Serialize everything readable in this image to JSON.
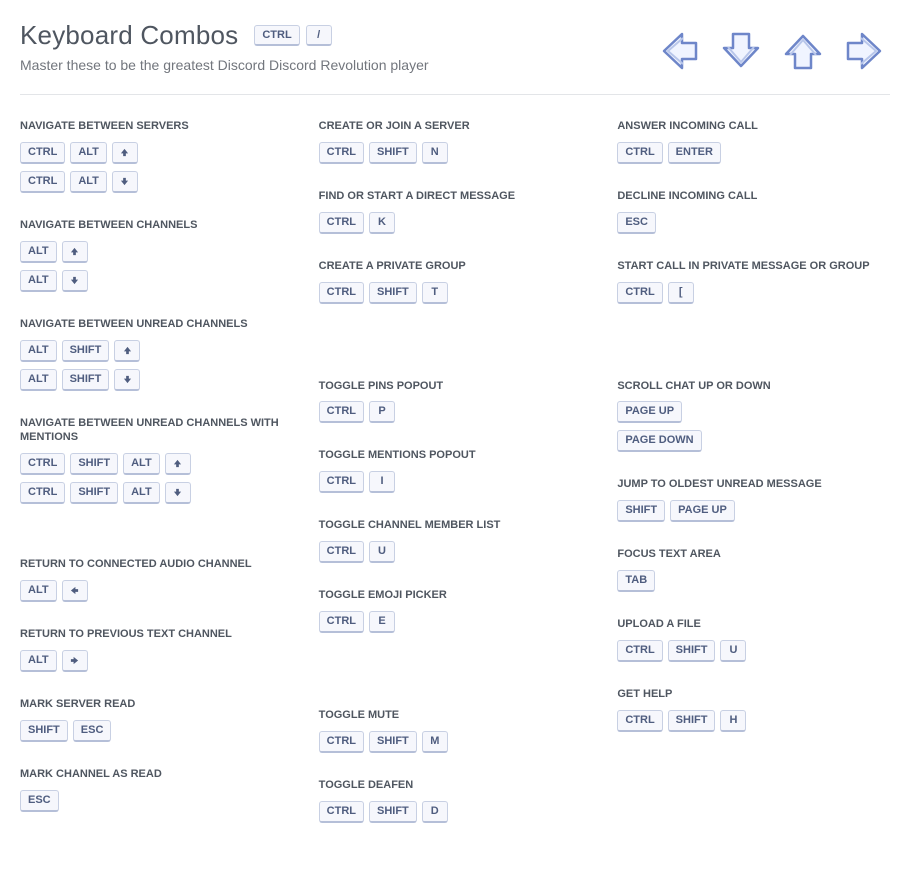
{
  "header": {
    "title": "Keyboard Combos",
    "title_keys": [
      "CTRL",
      "/"
    ],
    "subtitle": "Master these to be the greatest Discord Discord Revolution player"
  },
  "columns": [
    [
      {
        "label": "Navigate between servers",
        "combos": [
          [
            "CTRL",
            "ALT",
            "↑"
          ],
          [
            "CTRL",
            "ALT",
            "↓"
          ]
        ]
      },
      {
        "label": "Navigate between channels",
        "combos": [
          [
            "ALT",
            "↑"
          ],
          [
            "ALT",
            "↓"
          ]
        ]
      },
      {
        "label": "Navigate between unread channels",
        "combos": [
          [
            "ALT",
            "SHIFT",
            "↑"
          ],
          [
            "ALT",
            "SHIFT",
            "↓"
          ]
        ]
      },
      {
        "label": "Navigate between unread channels with mentions",
        "combos": [
          [
            "CTRL",
            "SHIFT",
            "ALT",
            "↑"
          ],
          [
            "CTRL",
            "SHIFT",
            "ALT",
            "↓"
          ]
        ]
      },
      {
        "spacer": "sm"
      },
      {
        "label": "Return to connected audio channel",
        "combos": [
          [
            "ALT",
            "←"
          ]
        ]
      },
      {
        "label": "Return to previous text channel",
        "combos": [
          [
            "ALT",
            "→"
          ]
        ]
      },
      {
        "label": "Mark server read",
        "combos": [
          [
            "SHIFT",
            "ESC"
          ]
        ]
      },
      {
        "label": "Mark channel as read",
        "combos": [
          [
            "ESC"
          ]
        ]
      }
    ],
    [
      {
        "label": "Create or join a server",
        "combos": [
          [
            "CTRL",
            "SHIFT",
            "N"
          ]
        ]
      },
      {
        "label": "Find or start a direct message",
        "combos": [
          [
            "CTRL",
            "K"
          ]
        ]
      },
      {
        "label": "Create a private group",
        "combos": [
          [
            "CTRL",
            "SHIFT",
            "T"
          ]
        ]
      },
      {
        "spacer": "md"
      },
      {
        "label": "Toggle pins popout",
        "combos": [
          [
            "CTRL",
            "P"
          ]
        ]
      },
      {
        "label": "Toggle mentions popout",
        "combos": [
          [
            "CTRL",
            "I"
          ]
        ]
      },
      {
        "label": "Toggle channel member list",
        "combos": [
          [
            "CTRL",
            "U"
          ]
        ]
      },
      {
        "label": "Toggle emoji picker",
        "combos": [
          [
            "CTRL",
            "E"
          ]
        ]
      },
      {
        "spacer": "md"
      },
      {
        "label": "Toggle mute",
        "combos": [
          [
            "CTRL",
            "SHIFT",
            "M"
          ]
        ]
      },
      {
        "label": "Toggle deafen",
        "combos": [
          [
            "CTRL",
            "SHIFT",
            "D"
          ]
        ]
      }
    ],
    [
      {
        "label": "Answer incoming call",
        "combos": [
          [
            "CTRL",
            "ENTER"
          ]
        ]
      },
      {
        "label": "Decline incoming call",
        "combos": [
          [
            "ESC"
          ]
        ]
      },
      {
        "label": "Start call in private message or group",
        "combos": [
          [
            "CTRL",
            "["
          ]
        ]
      },
      {
        "spacer": "md"
      },
      {
        "label": "Scroll chat up or down",
        "combos": [
          [
            "PAGE UP"
          ],
          [
            "PAGE DOWN"
          ]
        ]
      },
      {
        "label": "Jump to oldest unread message",
        "combos": [
          [
            "SHIFT",
            "PAGE UP"
          ]
        ]
      },
      {
        "label": "Focus text area",
        "combos": [
          [
            "TAB"
          ]
        ]
      },
      {
        "label": "Upload a file",
        "combos": [
          [
            "CTRL",
            "SHIFT",
            "U"
          ]
        ]
      },
      {
        "label": "Get help",
        "combos": [
          [
            "CTRL",
            "SHIFT",
            "H"
          ]
        ]
      }
    ]
  ]
}
